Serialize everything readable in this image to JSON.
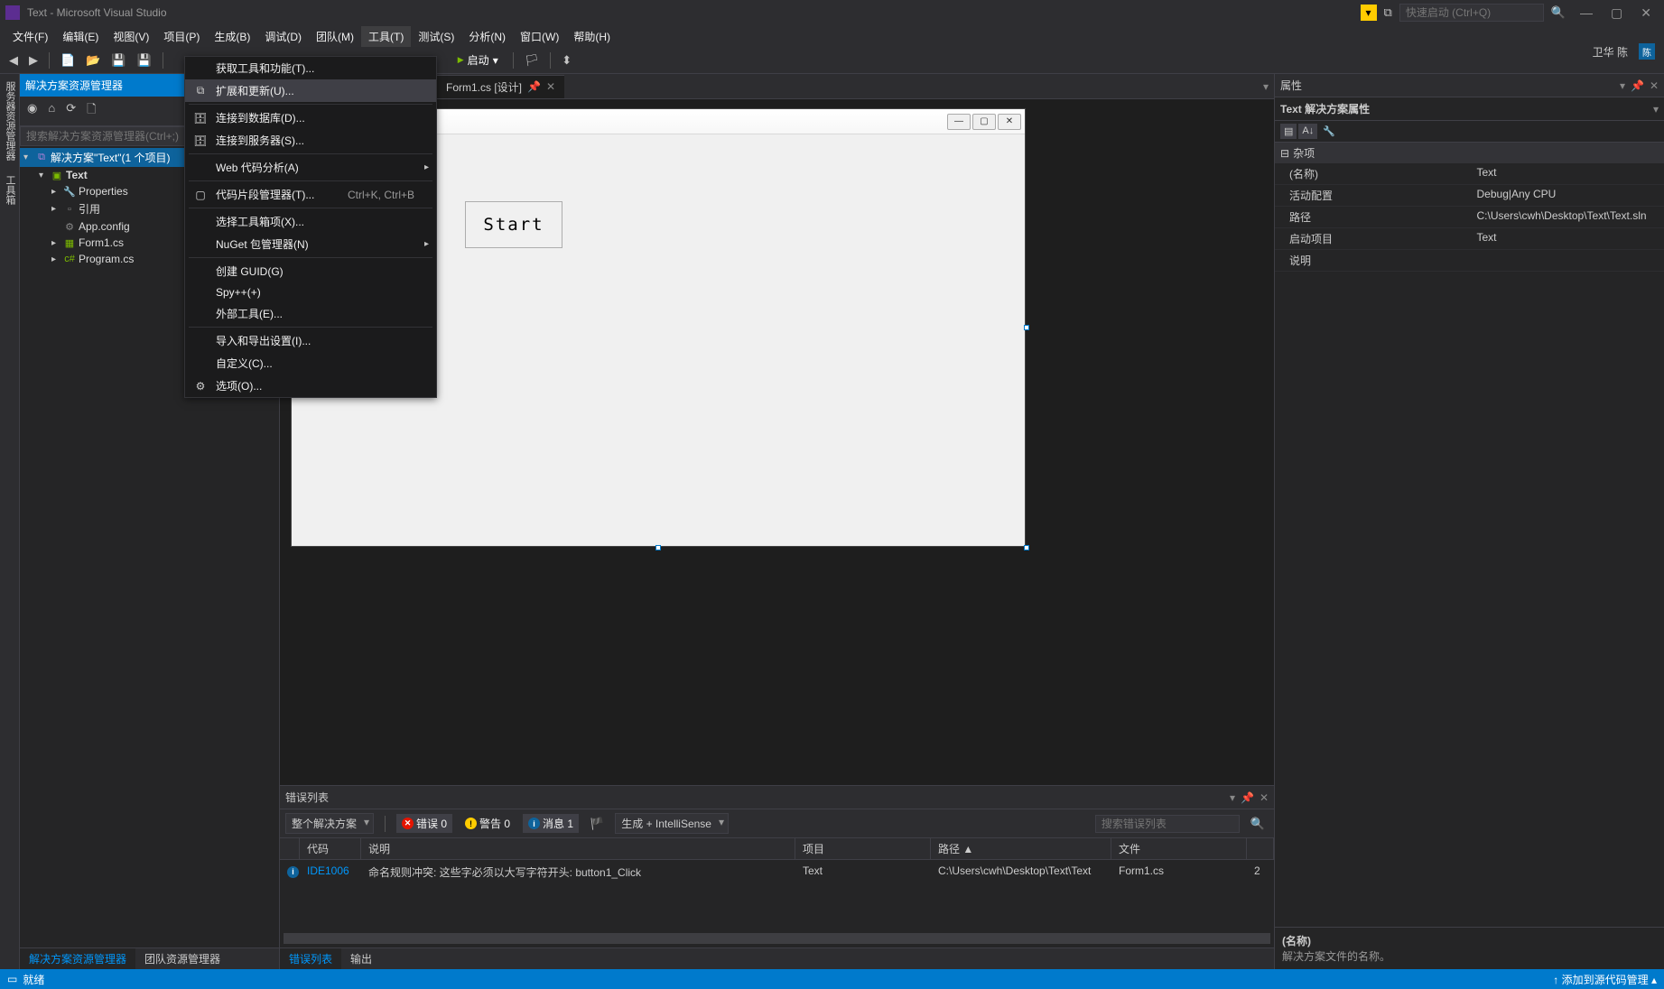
{
  "title": "Text - Microsoft Visual Studio",
  "quick_launch_placeholder": "快速启动 (Ctrl+Q)",
  "user_name": "卫华 陈",
  "menu": {
    "file": "文件(F)",
    "edit": "编辑(E)",
    "view": "视图(V)",
    "project": "项目(P)",
    "build": "生成(B)",
    "debug": "调试(D)",
    "team": "团队(M)",
    "tools": "工具(T)",
    "test": "测试(S)",
    "analyze": "分析(N)",
    "window": "窗口(W)",
    "help": "帮助(H)"
  },
  "toolbar": {
    "start": "启动"
  },
  "tools_menu": {
    "get_tools": "获取工具和功能(T)...",
    "ext_updates": "扩展和更新(U)...",
    "connect_db": "连接到数据库(D)...",
    "connect_srv": "连接到服务器(S)...",
    "web_analysis": "Web 代码分析(A)",
    "snippet_mgr": "代码片段管理器(T)...",
    "snippet_shortcut": "Ctrl+K, Ctrl+B",
    "toolbox": "选择工具箱项(X)...",
    "nuget": "NuGet 包管理器(N)",
    "create_guid": "创建 GUID(G)",
    "spypp": "Spy++(+)",
    "external": "外部工具(E)...",
    "import_export": "导入和导出设置(I)...",
    "customize": "自定义(C)...",
    "options": "选项(O)..."
  },
  "solution": {
    "panel_title": "解决方案资源管理器",
    "search_placeholder": "搜索解决方案资源管理器(Ctrl+;)",
    "root": "解决方案\"Text\"(1 个项目)",
    "project": "Text",
    "nodes": {
      "properties": "Properties",
      "refs": "引用",
      "appconfig": "App.config",
      "form1": "Form1.cs",
      "program": "Program.cs"
    },
    "tabs": {
      "solution": "解决方案资源管理器",
      "team": "团队资源管理器"
    }
  },
  "document": {
    "tab_title": "Form1.cs [设计]",
    "button_text": "Start"
  },
  "error_panel": {
    "title": "错误列表",
    "scope": "整个解决方案",
    "errors": "错误 0",
    "warnings": "警告 0",
    "messages": "消息 1",
    "build_filter": "生成 + IntelliSense",
    "search_placeholder": "搜索错误列表",
    "headers": {
      "code": "代码",
      "desc": "说明",
      "project": "项目",
      "path": "路径 ▲",
      "file": "文件"
    },
    "row": {
      "code": "IDE1006",
      "desc": "命名规则冲突: 这些字必须以大写字符开头: button1_Click",
      "project": "Text",
      "path": "C:\\Users\\cwh\\Desktop\\Text\\Text",
      "file": "Form1.cs",
      "line": "2"
    },
    "tabs": {
      "errors": "错误列表",
      "output": "输出"
    }
  },
  "properties": {
    "title": "属性",
    "selected": "Text 解决方案属性",
    "cat_misc": "杂项",
    "rows": {
      "name_k": "(名称)",
      "name_v": "Text",
      "activecfg_k": "活动配置",
      "activecfg_v": "Debug|Any CPU",
      "path_k": "路径",
      "path_v": "C:\\Users\\cwh\\Desktop\\Text\\Text.sln",
      "startup_k": "启动项目",
      "startup_v": "Text",
      "desc_k": "说明",
      "desc_v": ""
    },
    "help_title": "(名称)",
    "help_desc": "解决方案文件的名称。"
  },
  "status": {
    "ready": "就绪",
    "source_control": "添加到源代码管理"
  }
}
